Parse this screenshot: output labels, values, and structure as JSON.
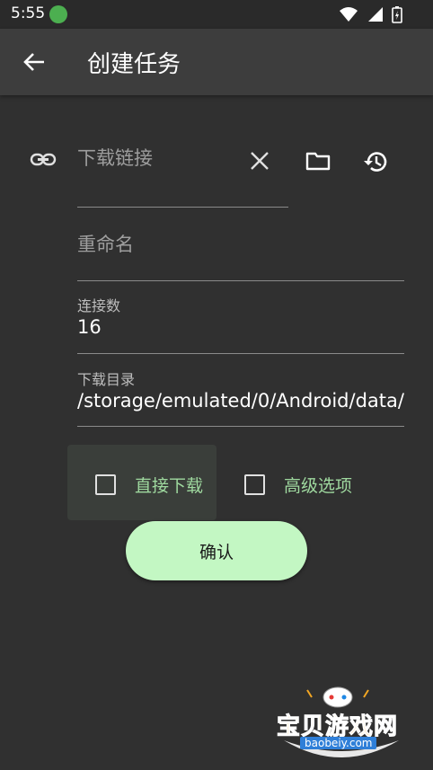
{
  "status_bar": {
    "time": "5:55"
  },
  "app_bar": {
    "title": "创建任务"
  },
  "form": {
    "url_placeholder": "下载链接",
    "rename_placeholder": "重命名",
    "connections_label": "连接数",
    "connections_value": "16",
    "directory_label": "下载目录",
    "directory_value": "/storage/emulated/0/Android/data/"
  },
  "options": {
    "direct_download": {
      "label": "直接下载",
      "checked": false
    },
    "advanced_options": {
      "label": "高级选项",
      "checked": false
    }
  },
  "actions": {
    "confirm_label": "确认"
  },
  "watermark": {
    "text": "宝贝游戏网",
    "url": "baobeiy.com"
  },
  "colors": {
    "background": "#303030",
    "app_bar": "#3d3d3d",
    "accent_green": "#9fd99f",
    "button_green": "#c3f7c3"
  },
  "icons": [
    "status-app-icon",
    "wifi-icon",
    "signal-icon",
    "battery-icon",
    "back-arrow-icon",
    "link-icon",
    "clear-icon",
    "folder-icon",
    "history-icon",
    "checkbox-icon"
  ]
}
